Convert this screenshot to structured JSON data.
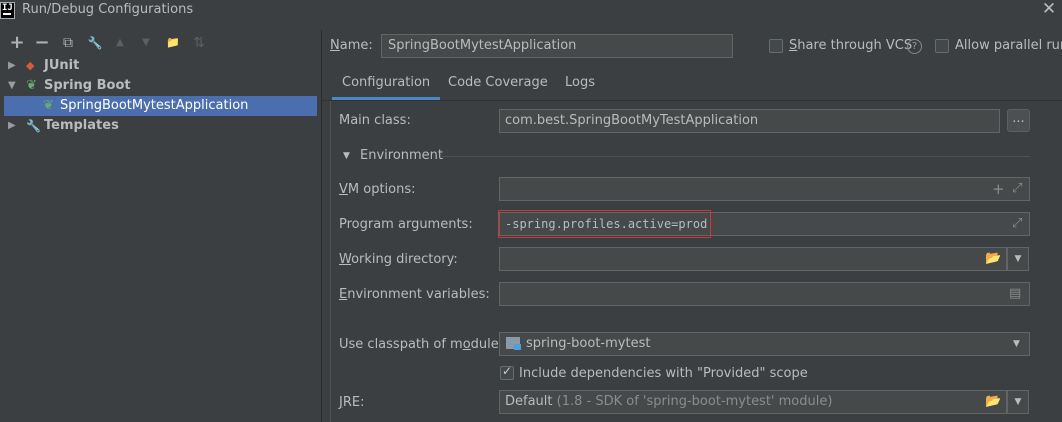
{
  "window": {
    "title": "Run/Debug Configurations",
    "app_icon_text": "IJ",
    "close_glyph": "✕"
  },
  "toolbar": {
    "buttons": [
      {
        "name": "add-icon",
        "glyph": "+"
      },
      {
        "name": "remove-icon",
        "glyph": "−"
      },
      {
        "name": "copy-icon",
        "glyph": "⧉"
      },
      {
        "name": "wrench-icon",
        "glyph": "🔧"
      },
      {
        "name": "move-up-icon",
        "glyph": "▲"
      },
      {
        "name": "move-down-icon",
        "glyph": "▼"
      },
      {
        "name": "new-folder-icon",
        "glyph": "📁"
      },
      {
        "name": "sort-icon",
        "glyph": "⇅"
      }
    ]
  },
  "tree": {
    "items": [
      {
        "label": "JUnit",
        "icon": "junit-icon"
      },
      {
        "label": "Spring Boot",
        "icon": "spring-boot-icon"
      },
      {
        "label": "SpringBootMytestApplication",
        "icon": "spring-boot-app-icon"
      },
      {
        "label": "Templates",
        "icon": "wrench-icon"
      }
    ]
  },
  "header": {
    "name_label": "Name:",
    "name_value": "SpringBootMytestApplication",
    "share_vcs_label": "Share through VCS",
    "allow_parallel_label": "Allow parallel run",
    "help_glyph": "?"
  },
  "tabs": [
    {
      "label": "Configuration"
    },
    {
      "label": "Code Coverage"
    },
    {
      "label": "Logs"
    }
  ],
  "form": {
    "main_class_label": "Main class:",
    "main_class_value": "com.best.SpringBootMyTestApplication",
    "ellipsis": "...",
    "environment_label": "Environment",
    "vm_options_label": "VM options:",
    "vm_options_value": "",
    "program_args_label": "Program arguments:",
    "program_args_value": "-spring.profiles.active=prod",
    "working_dir_label": "Working directory:",
    "working_dir_value": "",
    "env_vars_label": "Environment variables:",
    "env_vars_value": "",
    "classpath_label": "Use classpath of module:",
    "classpath_value": "spring-boot-mytest",
    "include_deps_label": "Include dependencies with \"Provided\" scope",
    "jre_label": "JRE:",
    "jre_value": "Default",
    "jre_detail": "(1.8 - SDK of 'spring-boot-mytest' module)"
  },
  "colors": {
    "background": "#3c3f41",
    "selection": "#4b6eaf",
    "tab_underline": "#4a88c7",
    "highlight_border": "#c83232",
    "spring_green": "#6aab73"
  }
}
